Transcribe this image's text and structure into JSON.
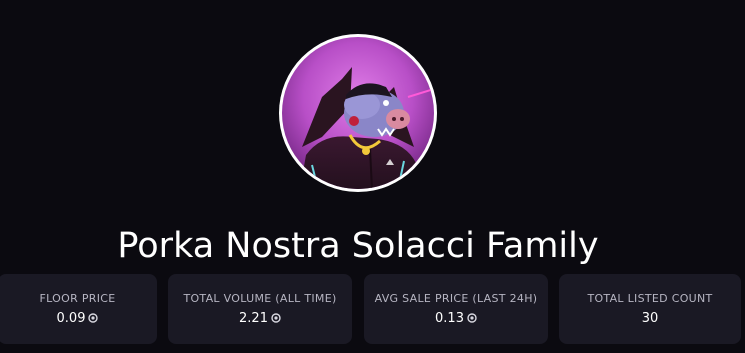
{
  "collection": {
    "name": "Porka Nostra Solacci Family",
    "avatar_alt": "collection-avatar"
  },
  "stats": [
    {
      "label": "FLOOR PRICE",
      "value": "0.09",
      "currency_icon": "sol-coin-icon"
    },
    {
      "label": "TOTAL VOLUME (ALL TIME)",
      "value": "2.21",
      "currency_icon": "sol-coin-icon"
    },
    {
      "label": "AVG SALE PRICE (LAST 24H)",
      "value": "0.13",
      "currency_icon": "sol-coin-icon"
    },
    {
      "label": "TOTAL LISTED COUNT",
      "value": "30",
      "currency_icon": ""
    }
  ],
  "colors": {
    "background": "#0b0a10",
    "card": "#1a1924",
    "label": "#b6b5c2",
    "accent_magenta": "#c04fd0"
  }
}
